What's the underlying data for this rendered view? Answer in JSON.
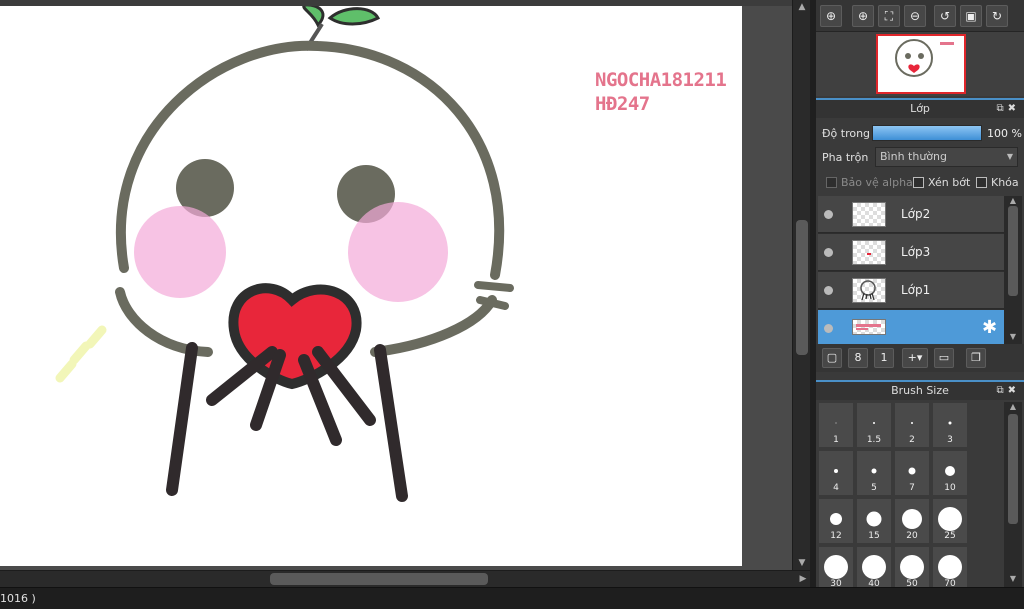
{
  "canvas": {
    "watermark_line1": "NGOCHA181211",
    "watermark_line2": "HĐ247"
  },
  "status": {
    "text": "1016 )"
  },
  "toolbar": {
    "icons": [
      "zoom-reset-icon",
      "zoom-in-icon",
      "fit-icon",
      "zoom-out-icon",
      "rotate-left-icon",
      "fullscreen-icon",
      "rotate-right-icon"
    ]
  },
  "layer_panel": {
    "title": "Lớp",
    "opacity_label": "Độ trong",
    "opacity_value": "100 %",
    "opacity_fraction": 1.0,
    "blend_label": "Pha trộn",
    "blend_value": "Bình thường",
    "protect_alpha_label": "Bảo vệ alpha",
    "clipping_label": "Xén bớt",
    "lock_label": "Khóa",
    "layers": [
      {
        "name": "Lớp2",
        "selected": false
      },
      {
        "name": "Lớp3",
        "selected": false
      },
      {
        "name": "Lớp1",
        "selected": false
      },
      {
        "name": "",
        "selected": true
      }
    ]
  },
  "brush_panel": {
    "title": "Brush Size",
    "sizes": [
      "1",
      "1.5",
      "2",
      "3",
      "4",
      "5",
      "7",
      "10",
      "12",
      "15",
      "20",
      "25",
      "30",
      "40",
      "50",
      "70"
    ]
  },
  "colors": {
    "accent": "#4e9ad8",
    "watermark": "#e4748c",
    "navigator_frame": "#e0262b"
  }
}
